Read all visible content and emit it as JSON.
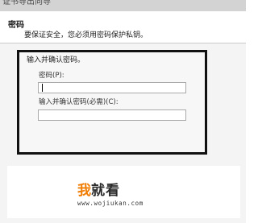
{
  "window": {
    "title": "证书导出向导"
  },
  "header": {
    "section_title": "密码",
    "description": "要保证安全，您必须用密码保护私钥。"
  },
  "password_group": {
    "label": "输入并确认密码。",
    "password_label": "密码(P):",
    "password_value": "",
    "confirm_label": "输入并确认密码(必需)(C):",
    "confirm_value": ""
  },
  "watermark": {
    "logo_part1": "我",
    "logo_part2": "就看",
    "url": "www.wojiukan.com",
    "colors": {
      "accent": "#f07c00",
      "dark": "#2b2b2b"
    }
  }
}
